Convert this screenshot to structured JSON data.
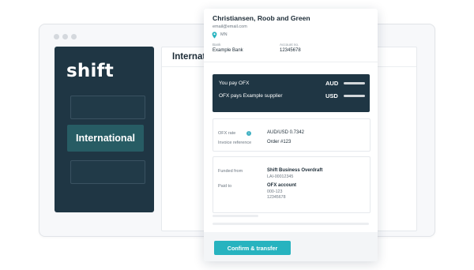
{
  "sidebar": {
    "logo": "shift",
    "active_item": "International"
  },
  "main": {
    "title": "Internat"
  },
  "payee": {
    "name": "Christiansen, Roob and Green",
    "email": "email@email.com",
    "location": "MN",
    "bank_label": "Bank",
    "bank_value": "Example Bank",
    "account_label": "Account no.",
    "account_value": "12345678"
  },
  "payment": {
    "you_pay_label": "You pay OFX",
    "you_pay_currency": "AUD",
    "ofx_pays_label": "OFX pays Example supplier",
    "ofx_pays_currency": "USD"
  },
  "rate": {
    "rate_label": "OFX rate",
    "rate_value": "AUD/USD 0.7342",
    "reference_label": "Invoice reference",
    "reference_value": "Order #123"
  },
  "funding": {
    "funded_label": "Funded from",
    "funded_value": "Shift Business Overdraft",
    "funded_sub": "LAI-00012345",
    "paid_label": "Paid to",
    "paid_value": "OFX account",
    "paid_sub1": "000-123",
    "paid_sub2": "12345678"
  },
  "actions": {
    "confirm_label": "Confirm & transfer"
  },
  "colors": {
    "dark_navy": "#1f3644",
    "teal_active": "#275c64",
    "accent_teal": "#27b3bf"
  }
}
